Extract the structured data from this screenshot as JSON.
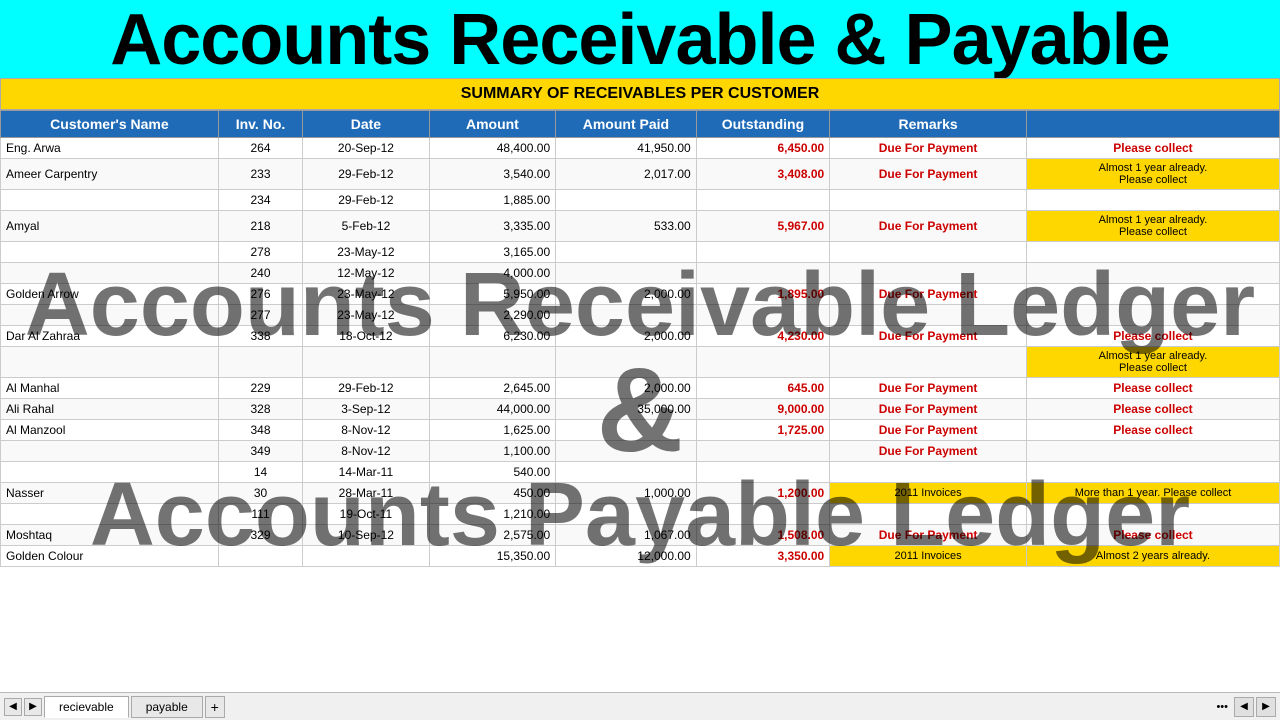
{
  "header": {
    "title": "Accounts Receivable & Payable",
    "bg_color": "cyan"
  },
  "summary_title": "SUMMARY OF RECEIVABLES PER CUSTOMER",
  "columns": [
    "Customer's Name",
    "Inv. No.",
    "Date",
    "Amount",
    "Amount Paid",
    "Outstanding",
    "Remarks",
    ""
  ],
  "rows": [
    {
      "name": "Eng. Arwa",
      "inv": "264",
      "date": "20-Sep-12",
      "amount": "48,400.00",
      "paid": "41,950.00",
      "outstanding": "6,450.00",
      "outstanding_red": true,
      "remarks": "Due For Payment",
      "remarks_type": "red",
      "action": "Please collect",
      "action_type": "plain"
    },
    {
      "name": "Ameer Carpentry",
      "inv": "233",
      "date": "29-Feb-12",
      "amount": "3,540.00",
      "paid": "2,017.00",
      "outstanding": "3,408.00",
      "outstanding_red": true,
      "remarks": "Due For Payment",
      "remarks_type": "red",
      "action": "Almost 1 year already.\nPlease collect",
      "action_type": "yellow"
    },
    {
      "name": "",
      "inv": "234",
      "date": "29-Feb-12",
      "amount": "1,885.00",
      "paid": "",
      "outstanding": "",
      "outstanding_red": false,
      "remarks": "",
      "remarks_type": "",
      "action": "",
      "action_type": ""
    },
    {
      "name": "Amyal",
      "inv": "218",
      "date": "5-Feb-12",
      "amount": "3,335.00",
      "paid": "533.00",
      "outstanding": "5,967.00",
      "outstanding_red": true,
      "remarks": "Due For Payment",
      "remarks_type": "red",
      "action": "Almost 1 year already.\nPlease collect",
      "action_type": "yellow"
    },
    {
      "name": "",
      "inv": "278",
      "date": "23-May-12",
      "amount": "3,165.00",
      "paid": "",
      "outstanding": "",
      "outstanding_red": false,
      "remarks": "",
      "remarks_type": "",
      "action": "",
      "action_type": ""
    },
    {
      "name": "",
      "inv": "240",
      "date": "12-May-12",
      "amount": "4,000.00",
      "paid": "",
      "outstanding": "",
      "outstanding_red": false,
      "remarks": "",
      "remarks_type": "",
      "action": "",
      "action_type": ""
    },
    {
      "name": "Golden Arrow",
      "inv": "276",
      "date": "23-May-12",
      "amount": "5,950.00",
      "paid": "2,000.00",
      "outstanding": "1,895.00",
      "outstanding_red": true,
      "remarks": "Due For Payment",
      "remarks_type": "red",
      "action": "",
      "action_type": ""
    },
    {
      "name": "",
      "inv": "277",
      "date": "23-May-12",
      "amount": "2,290.00",
      "paid": "",
      "outstanding": "",
      "outstanding_red": false,
      "remarks": "",
      "remarks_type": "",
      "action": "",
      "action_type": ""
    },
    {
      "name": "Dar Al Zahraa",
      "inv": "338",
      "date": "18-Oct-12",
      "amount": "6,230.00",
      "paid": "2,000.00",
      "outstanding": "4,230.00",
      "outstanding_red": true,
      "remarks": "Due For Payment",
      "remarks_type": "red",
      "action": "Please collect",
      "action_type": "plain"
    },
    {
      "name": "",
      "inv": "",
      "date": "",
      "amount": "",
      "paid": "",
      "outstanding": "",
      "outstanding_red": false,
      "remarks": "",
      "remarks_type": "",
      "action": "Almost 1 year already.\nPlease collect",
      "action_type": "yellow"
    },
    {
      "name": "Al Manhal",
      "inv": "229",
      "date": "29-Feb-12",
      "amount": "2,645.00",
      "paid": "2,000.00",
      "outstanding": "645.00",
      "outstanding_red": true,
      "remarks": "Due For Payment",
      "remarks_type": "red",
      "action": "Please collect",
      "action_type": "plain"
    },
    {
      "name": "Ali Rahal",
      "inv": "328",
      "date": "3-Sep-12",
      "amount": "44,000.00",
      "paid": "35,000.00",
      "outstanding": "9,000.00",
      "outstanding_red": true,
      "remarks": "Due For Payment",
      "remarks_type": "red",
      "action": "Please collect",
      "action_type": "plain"
    },
    {
      "name": "Al Manzool",
      "inv": "348",
      "date": "8-Nov-12",
      "amount": "1,625.00",
      "paid": "",
      "outstanding": "1,725.00",
      "outstanding_red": true,
      "remarks": "Due For Payment",
      "remarks_type": "red",
      "action": "Please collect",
      "action_type": "plain"
    },
    {
      "name": "",
      "inv": "349",
      "date": "8-Nov-12",
      "amount": "1,100.00",
      "paid": "",
      "outstanding": "",
      "outstanding_red": false,
      "remarks": "Due For Payment",
      "remarks_type": "red",
      "action": "",
      "action_type": ""
    },
    {
      "name": "",
      "inv": "14",
      "date": "14-Mar-11",
      "amount": "540.00",
      "paid": "",
      "outstanding": "",
      "outstanding_red": false,
      "remarks": "",
      "remarks_type": "",
      "action": "",
      "action_type": ""
    },
    {
      "name": "Nasser",
      "inv": "30",
      "date": "28-Mar-11",
      "amount": "450.00",
      "paid": "1,000.00",
      "outstanding": "1,200.00",
      "outstanding_red": true,
      "remarks": "2011 Invoices",
      "remarks_type": "yellow",
      "action": "More than 1 year. Please collect",
      "action_type": "yellow"
    },
    {
      "name": "",
      "inv": "111",
      "date": "19-Oct-11",
      "amount": "1,210.00",
      "paid": "",
      "outstanding": "",
      "outstanding_red": false,
      "remarks": "",
      "remarks_type": "",
      "action": "",
      "action_type": ""
    },
    {
      "name": "Moshtaq",
      "inv": "329",
      "date": "10-Sep-12",
      "amount": "2,575.00",
      "paid": "1,067.00",
      "outstanding": "1,508.00",
      "outstanding_red": true,
      "remarks": "Due For Payment",
      "remarks_type": "red",
      "action": "Please collect",
      "action_type": "plain"
    },
    {
      "name": "Golden Colour",
      "inv": "",
      "date": "",
      "amount": "15,350.00",
      "paid": "12,000.00",
      "outstanding": "3,350.00",
      "outstanding_red": true,
      "remarks": "2011 Invoices",
      "remarks_type": "yellow",
      "action": "Almost 2 years already.",
      "action_type": "yellow"
    }
  ],
  "watermark": {
    "line1": "Accounts Receivable Ledger",
    "line2": "&",
    "line3": "Accounts Payable Ledger"
  },
  "tabs": {
    "active": "recievable",
    "items": [
      "recievable",
      "payable"
    ]
  }
}
